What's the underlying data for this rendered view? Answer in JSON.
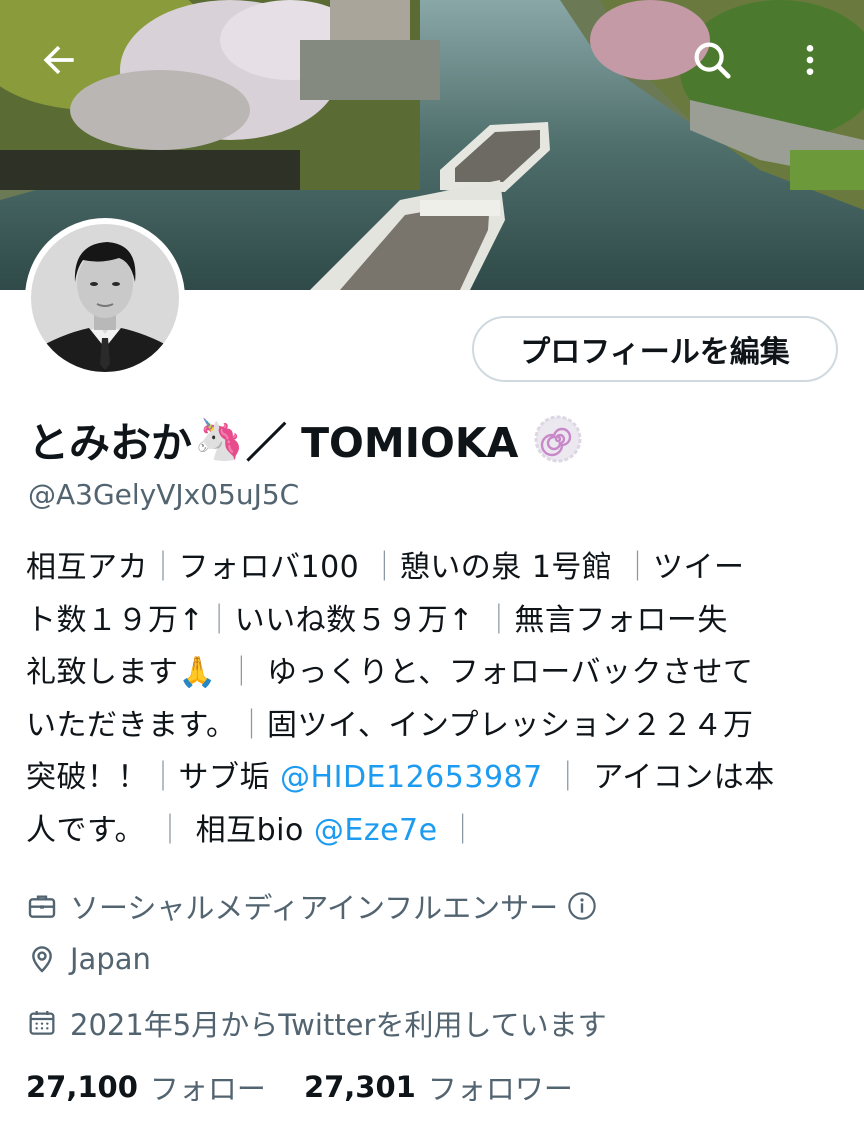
{
  "profile": {
    "name": "とみおか",
    "name_emoji": "🦄",
    "name_suffix": "／ TOMIOKA",
    "handle": "@A3GelyVJx05uJ5C",
    "edit_button": "プロフィールを編集"
  },
  "bio": {
    "line1": [
      "相互アカ",
      "｜",
      "フォロバ100",
      "｜",
      "憩いの泉 1号館",
      "｜",
      "ツイー"
    ],
    "line2": [
      "ト数１９万↑",
      "｜",
      "いいね数５９万↑",
      "｜",
      "無言フォロー失"
    ],
    "line3": [
      "礼致します",
      "🙏",
      "｜",
      "ゆっくりと、フォローバックさせて"
    ],
    "line4": [
      "いただきます。",
      "｜",
      "固ツイ、インプレッション２２４万"
    ],
    "line5": [
      "突破！！",
      "｜",
      "サブ垢",
      "@HIDE12653987",
      "｜",
      "アイコンは本"
    ],
    "line6": [
      "人です。",
      "｜",
      "相互bio",
      "@Eze7e",
      "｜"
    ]
  },
  "meta": {
    "category": "ソーシャルメディアインフルエンサー",
    "location": "Japan",
    "joined": "2021年5月からTwitterを利用しています"
  },
  "stats": {
    "following_count": "27,100",
    "following_label": "フォロー",
    "followers_count": "27,301",
    "followers_label": "フォロワー"
  },
  "icons": {
    "back": "arrow-left-icon",
    "search": "search-icon",
    "more": "more-vertical-icon",
    "badge": "spiral-badge-icon",
    "category": "briefcase-icon",
    "info": "info-icon",
    "location": "location-pin-icon",
    "joined": "calendar-icon"
  },
  "colors": {
    "text": "#0f1419",
    "secondary": "#536471",
    "link": "#1d9bf0",
    "border": "#cfd9de"
  }
}
